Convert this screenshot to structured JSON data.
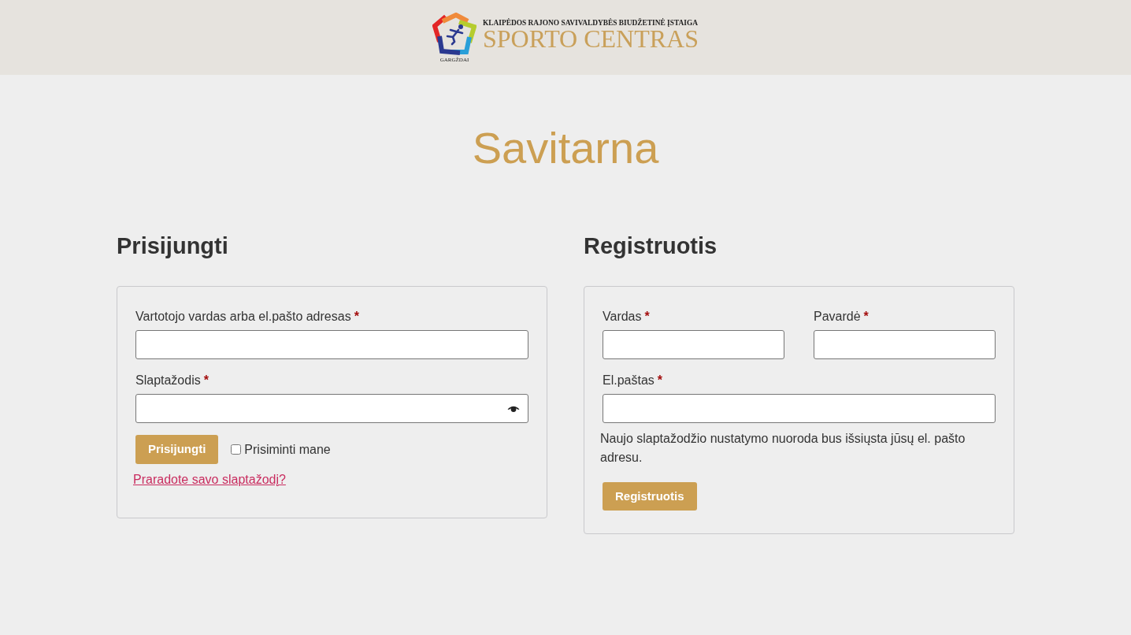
{
  "header": {
    "logo": {
      "town": "GARGŽDAI",
      "subtitle": "KLAIPĖDOS RAJONO SAVIVALDYBĖS BIUDŽETINĖ ĮSTAIGA",
      "title": "SPORTO CENTRAS"
    }
  },
  "page_title": "Savitarna",
  "login": {
    "heading": "Prisijungti",
    "rows": [
      {
        "fields": [
          {
            "label": "Vartotojo vardas arba el.pašto adresas",
            "required_mark": "*",
            "kind": "text"
          }
        ]
      },
      {
        "fields": [
          {
            "label": "Slaptažodis",
            "required_mark": "*",
            "kind": "password"
          }
        ]
      }
    ],
    "submit_button": "Prisijungti",
    "remember": {
      "label": "Prisiminti mane",
      "checked": false
    },
    "lost_password_link": "Praradote savo slaptažodį?"
  },
  "register": {
    "heading": "Registruotis",
    "rows": [
      {
        "fields": [
          {
            "label": "Vardas",
            "required_mark": "*",
            "kind": "text"
          },
          {
            "label": "Pavardė",
            "required_mark": "*",
            "kind": "text"
          }
        ]
      },
      {
        "fields": [
          {
            "label": "El.paštas",
            "required_mark": "*",
            "kind": "text"
          }
        ]
      }
    ],
    "note": "Naujo slaptažodžio nustatymo nuoroda bus išsiųsta jūsų el. pašto adresu.",
    "submit_button": "Registruotis"
  }
}
